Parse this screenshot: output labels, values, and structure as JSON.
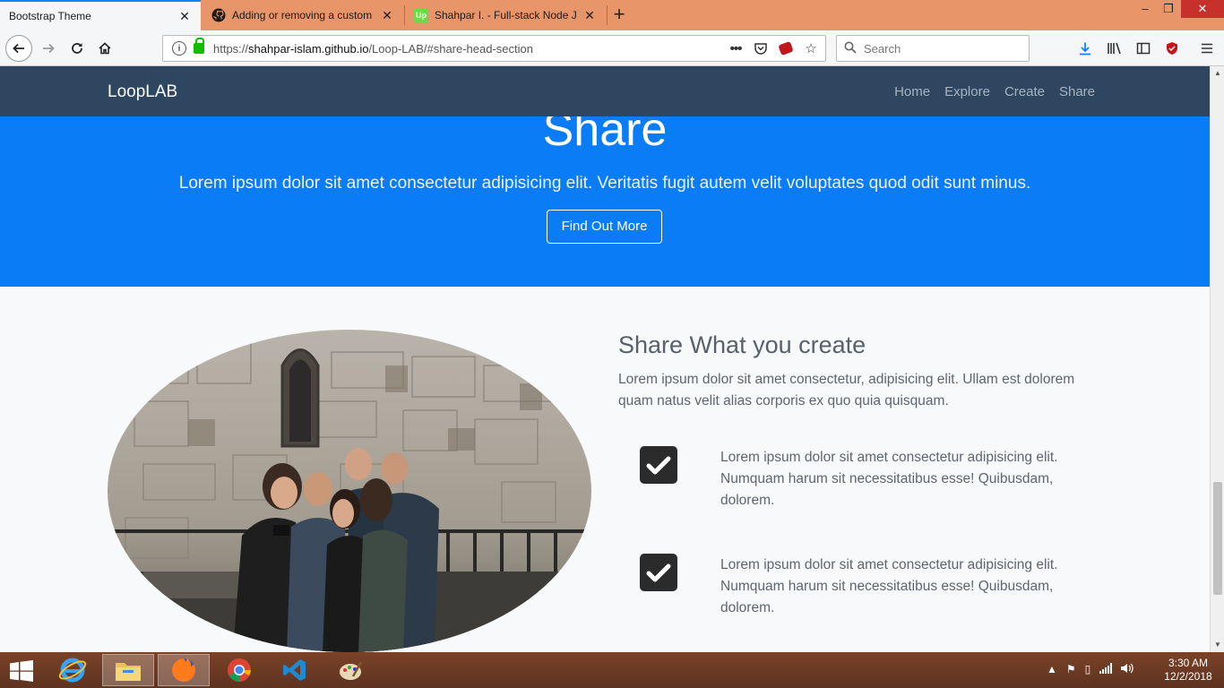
{
  "browser": {
    "tabs": [
      {
        "title": "Bootstrap Theme",
        "icon": "none",
        "active": true
      },
      {
        "title": "Adding or removing a custom",
        "icon": "github-icon",
        "active": false
      },
      {
        "title": "Shahpar I. - Full-stack Node JS",
        "icon": "upwork-icon",
        "icon_text": "Up",
        "active": false
      }
    ],
    "url_prefix": "https://",
    "url_domain": "shahpar-islam.github.io",
    "url_path": "/Loop-LAB/#share-head-section",
    "search_placeholder": "Search",
    "page_actions_icon": "•••"
  },
  "site": {
    "brand": "LoopLAB",
    "nav": [
      "Home",
      "Explore",
      "Create",
      "Share"
    ]
  },
  "hero": {
    "title": "Share",
    "subtitle": "Lorem ipsum dolor sit amet consectetur adipisicing elit. Veritatis fugit autem velit voluptates quod odit sunt minus.",
    "button": "Find Out More"
  },
  "feature": {
    "title": "Share What you create",
    "lead": "Lorem ipsum dolor sit amet consectetur, adipisicing elit. Ullam est dolorem quam natus velit alias corporis ex quo quia quisquam.",
    "items": [
      {
        "text": "Lorem ipsum dolor sit amet consectetur adipisicing elit. Numquam harum sit necessitatibus esse! Quibusdam, dolorem."
      },
      {
        "text": "Lorem ipsum dolor sit amet consectetur adipisicing elit. Numquam harum sit necessitatibus esse! Quibusdam, dolorem."
      }
    ]
  },
  "taskbar": {
    "apps": [
      "internet-explorer-icon",
      "file-explorer-icon",
      "firefox-icon",
      "chrome-icon",
      "vscode-icon",
      "paint-icon"
    ],
    "time": "3:30 AM",
    "date": "12/2/2018"
  },
  "colors": {
    "hero_bg": "#0a7cf5",
    "nav_bg": "#2e4660",
    "tabstrip_bg": "#e8956a",
    "check_bg": "#2b2b2b"
  }
}
